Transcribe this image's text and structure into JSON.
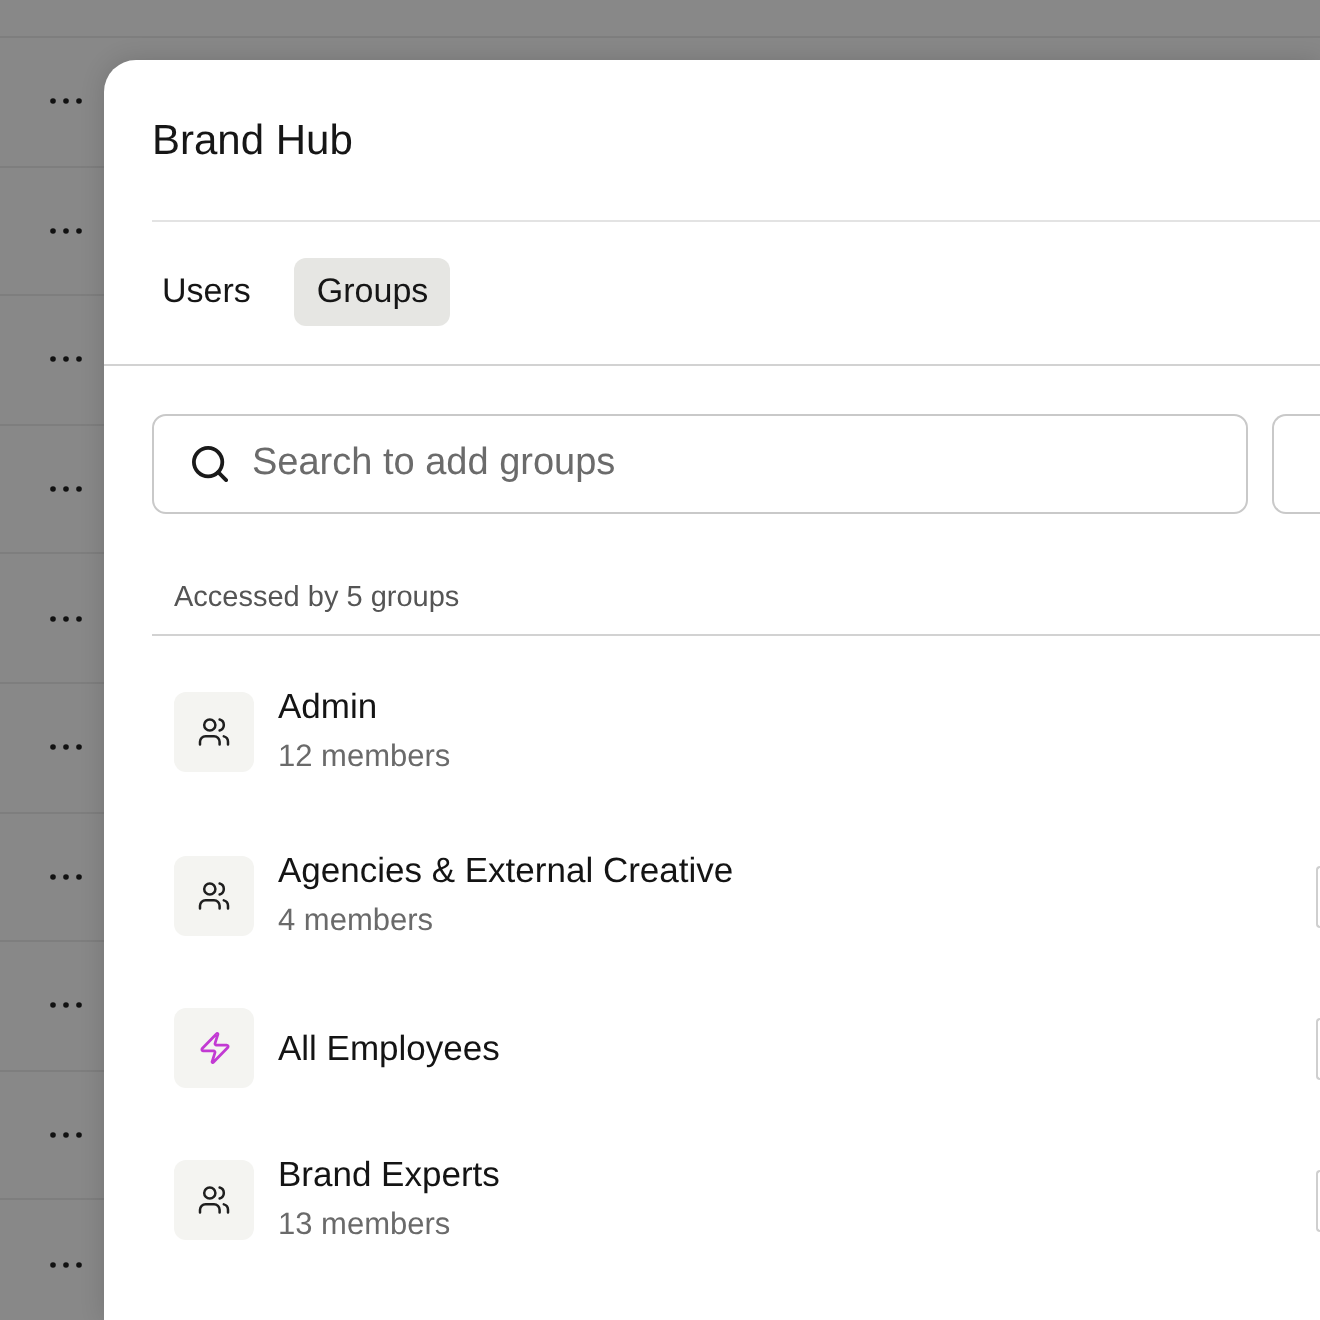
{
  "dialog": {
    "title": "Brand Hub"
  },
  "tabs": [
    {
      "label": "Users",
      "selected": false
    },
    {
      "label": "Groups",
      "selected": true
    }
  ],
  "search": {
    "placeholder": "Search to add groups"
  },
  "access_summary": "Accessed by 5 groups",
  "groups": [
    {
      "kind": "group",
      "name": "Admin",
      "members": "12 members",
      "action_button": false
    },
    {
      "kind": "group",
      "name": "Agencies & External Creative",
      "members": "4 members",
      "action_button": true
    },
    {
      "kind": "dynamic",
      "name": "All Employees",
      "action_button": true
    },
    {
      "kind": "group",
      "name": "Brand Experts",
      "members": "13 members",
      "action_button": true
    }
  ]
}
